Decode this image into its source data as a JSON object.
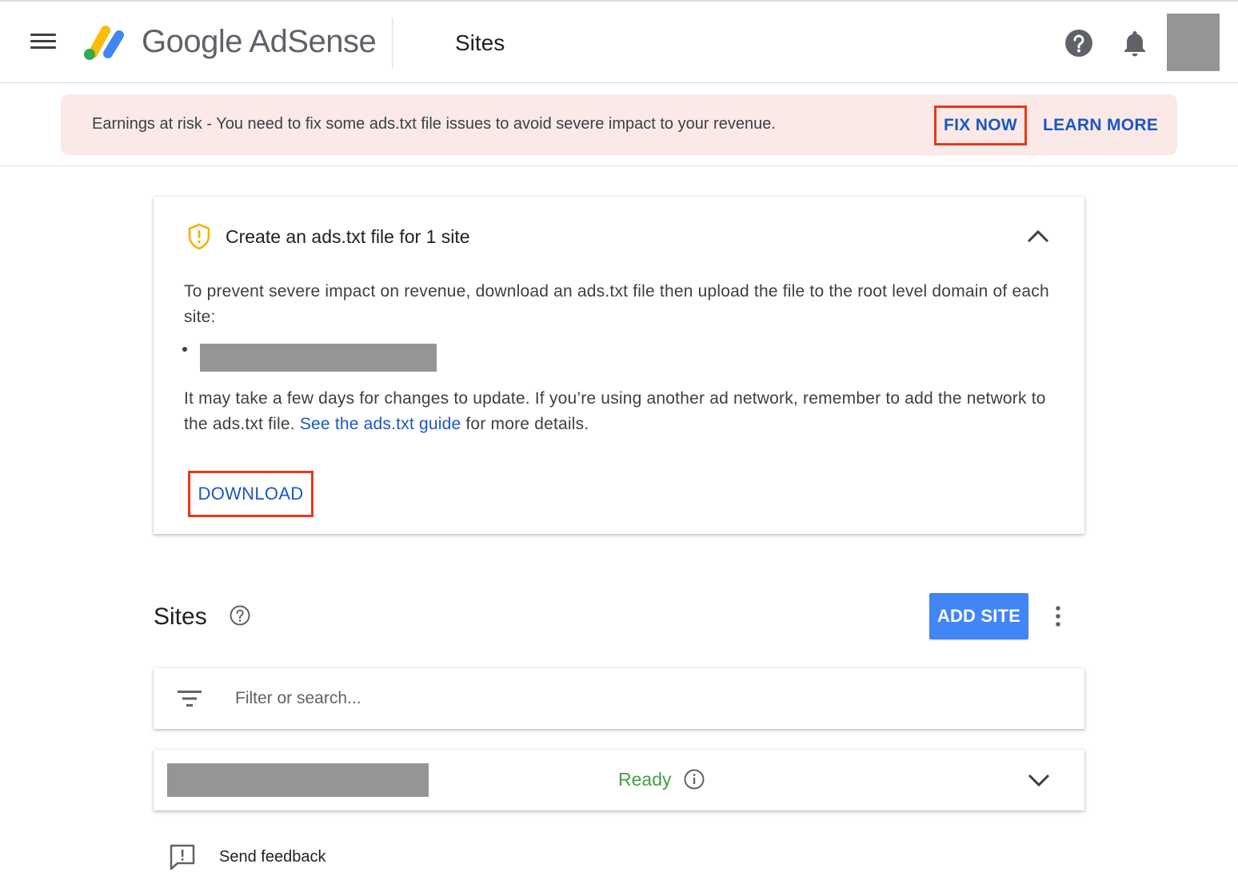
{
  "header": {
    "brand_google": "Google",
    "brand_product": "AdSense",
    "page_title": "Sites"
  },
  "banner": {
    "message": "Earnings at risk - You need to fix some ads.txt file issues to avoid severe impact to your revenue.",
    "fix_now_label": "FIX NOW",
    "learn_more_label": "LEARN MORE",
    "background_color": "#fbe9e7"
  },
  "ads_txt_card": {
    "title": "Create an ads.txt file for 1 site",
    "instruction": "To prevent severe impact on revenue, download an ads.txt file then upload the file to the root level domain of each site:",
    "note_before_link": "It may take a few days for changes to update. If you’re using another ad network, remember to add the network to the ads.txt file. ",
    "guide_link_label": "See the ads.txt guide",
    "note_after_link": " for more details.",
    "download_label": "DOWNLOAD",
    "warning_color": "#f4b400"
  },
  "sites_section": {
    "heading": "Sites",
    "add_site_label": "ADD SITE",
    "filter_placeholder": "Filter or search...",
    "rows": [
      {
        "status": "Ready",
        "status_color": "#43a047"
      }
    ]
  },
  "footer": {
    "feedback_label": "Send feedback"
  },
  "colors": {
    "link_blue": "#1a57c5",
    "primary_button": "#4285f4",
    "highlight_red": "#e8381a"
  },
  "icons": [
    "menu-icon",
    "adsense-logo",
    "help-icon",
    "bell-icon",
    "shield-warning-icon",
    "chevron-up-icon",
    "help-circle-icon",
    "more-vert-icon",
    "filter-icon",
    "info-icon",
    "chevron-down-icon",
    "feedback-icon"
  ]
}
